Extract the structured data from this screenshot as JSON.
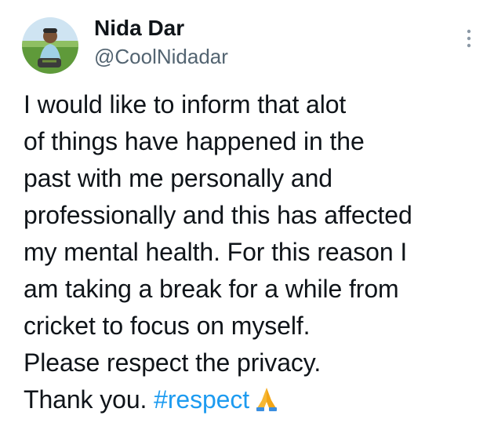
{
  "author": {
    "name": "Nida Dar",
    "handle": "@CoolNidadar",
    "avatar_icon": "profile-avatar"
  },
  "menu": {
    "icon": "more-vertical-icon"
  },
  "tweet": {
    "lines": [
      "I would like to inform that alot",
      "of things have happened in the",
      "past with me personally and",
      "professionally and this has affected",
      "my mental health. For this reason I",
      "am taking a break for a while from",
      "cricket to focus on myself.",
      "Please respect the privacy."
    ],
    "last_line_text": "Thank you.",
    "hashtag": "#respect",
    "emoji_icon": "folded-hands-icon"
  },
  "colors": {
    "text": "#0f1419",
    "secondary": "#536471",
    "link": "#1d9bf0"
  }
}
